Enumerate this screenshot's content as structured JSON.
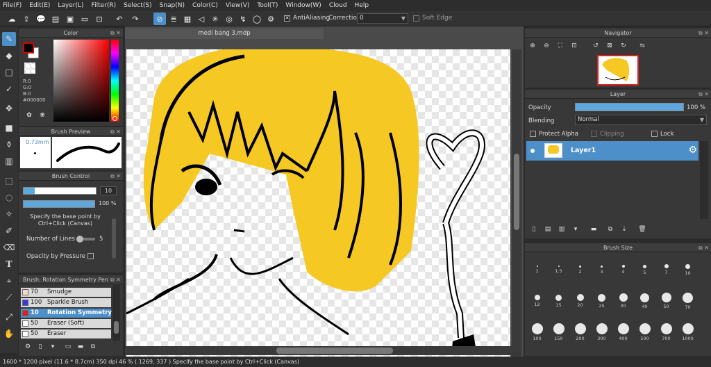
{
  "menu": [
    "File(F)",
    "Edit(E)",
    "Layer(L)",
    "Filter(R)",
    "Select(S)",
    "Snap(N)",
    "Color(C)",
    "View(V)",
    "Tool(T)",
    "Window(W)",
    "Cloud",
    "Help"
  ],
  "toolbar": {
    "antialiasing_label": "AntiAliasing",
    "correction_label": "Correction",
    "correction_value": "0",
    "soft_edge_label": "Soft Edge"
  },
  "color_panel": {
    "title": "Color",
    "r": "R:0",
    "g": "G:0",
    "b": "B:0",
    "hex": "#000000",
    "fg_color": "#000000",
    "bg_color": "#ffffff",
    "accent": "#cc0000"
  },
  "brush_preview": {
    "title": "Brush Preview",
    "size": "0.73mm"
  },
  "brush_control": {
    "title": "Brush Control",
    "size_value": "10",
    "opacity_value": "100 %",
    "hint": "Specify the base point by Ctrl+Click (Canvas)",
    "lines_label": "Number of Lines",
    "lines_value": "5",
    "opacity_pressure_label": "Opacity by Pressure"
  },
  "brush_list": {
    "title": "Brush: Rotation Symmetry Pen",
    "items": [
      {
        "num": "70",
        "name": "Smudge",
        "color": "#f2d9d0"
      },
      {
        "num": "100",
        "name": "Sparkle Brush",
        "color": "#3a3adc"
      },
      {
        "num": "10",
        "name": "Rotation Symmetry",
        "color": "#e02020"
      },
      {
        "num": "50",
        "name": "Eraser (Soft)",
        "color": "#ffffff"
      },
      {
        "num": "50",
        "name": "Eraser",
        "color": "#ffffff"
      }
    ]
  },
  "document_tab": "medi bang 3.mdp",
  "navigator": {
    "title": "Navigator"
  },
  "layer_panel": {
    "title": "Layer",
    "opacity_label": "Opacity",
    "opacity_value": "100 %",
    "opacity_fraction": 1.0,
    "blending_label": "Blending",
    "blending_value": "Normal",
    "protect_alpha": "Protect Alpha",
    "clipping": "Clipping",
    "lock": "Lock",
    "layers": [
      {
        "name": "Layer1"
      }
    ]
  },
  "brush_size": {
    "title": "Brush Size",
    "sizes": [
      "1",
      "1.5",
      "2",
      "3",
      "4",
      "5",
      "7",
      "10",
      "12",
      "15",
      "20",
      "25",
      "30",
      "40",
      "50",
      "70",
      "100",
      "150",
      "200",
      "300",
      "400",
      "500",
      "700",
      "1000"
    ]
  },
  "status": {
    "text": "1600 * 1200 pixel  (11.6 * 8.7cm)  350 dpi  46 %  ( 1269, 337 )  Specify the base point by Ctrl+Click (Canvas)"
  },
  "icons": [
    "brush-icon",
    "eraser-icon",
    "rect-icon",
    "pen-icon",
    "move-icon",
    "fill-icon",
    "bucket-icon",
    "gradient-icon",
    "select-icon",
    "lasso-icon",
    "magic-wand-icon",
    "select-pen-icon",
    "select-eraser-icon",
    "text-icon",
    "operation-icon",
    "divide-icon",
    "eyedropper-icon",
    "hand-icon"
  ]
}
